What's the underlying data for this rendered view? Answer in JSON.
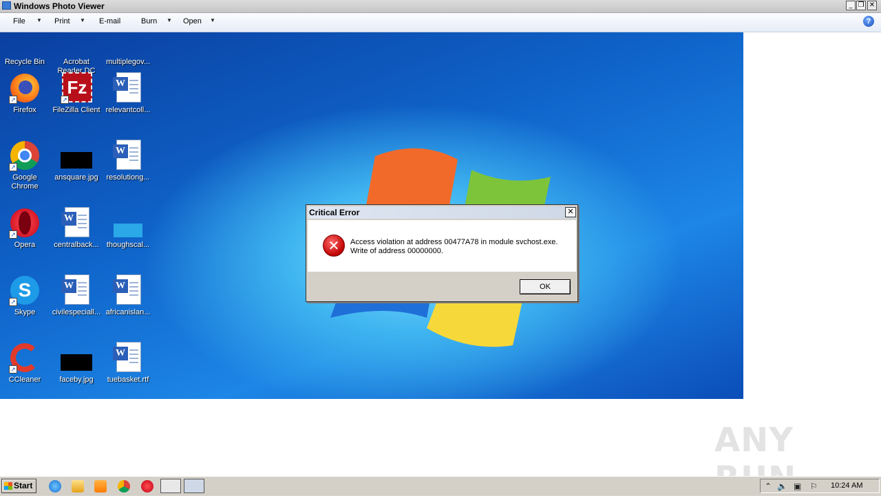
{
  "window": {
    "title": "Windows Photo Viewer"
  },
  "menu": {
    "file": "File",
    "print": "Print",
    "email": "E-mail",
    "burn": "Burn",
    "open": "Open"
  },
  "desktop": {
    "icons": [
      {
        "label": "Recycle Bin"
      },
      {
        "label": "Acrobat Reader DC"
      },
      {
        "label": "multiplegov..."
      },
      {
        "label": "Firefox"
      },
      {
        "label": "FileZilla Client"
      },
      {
        "label": "relevantcoll..."
      },
      {
        "label": "Google Chrome"
      },
      {
        "label": "ansquare.jpg"
      },
      {
        "label": "resolutiong..."
      },
      {
        "label": "Opera"
      },
      {
        "label": "centralback..."
      },
      {
        "label": "thoughscal..."
      },
      {
        "label": "Skype"
      },
      {
        "label": "civilespeciall..."
      },
      {
        "label": "africanislan..."
      },
      {
        "label": "CCleaner"
      },
      {
        "label": "faceby.jpg"
      },
      {
        "label": "tuebasket.rtf"
      }
    ]
  },
  "dialog": {
    "title": "Critical Error",
    "line1": "Access violation at address 00477A78 in module svchost.exe.",
    "line2": "Write of address 00000000.",
    "ok": "OK"
  },
  "watermark": "ANY RUN",
  "taskbar": {
    "start": "Start",
    "clock": "10:24 AM"
  }
}
